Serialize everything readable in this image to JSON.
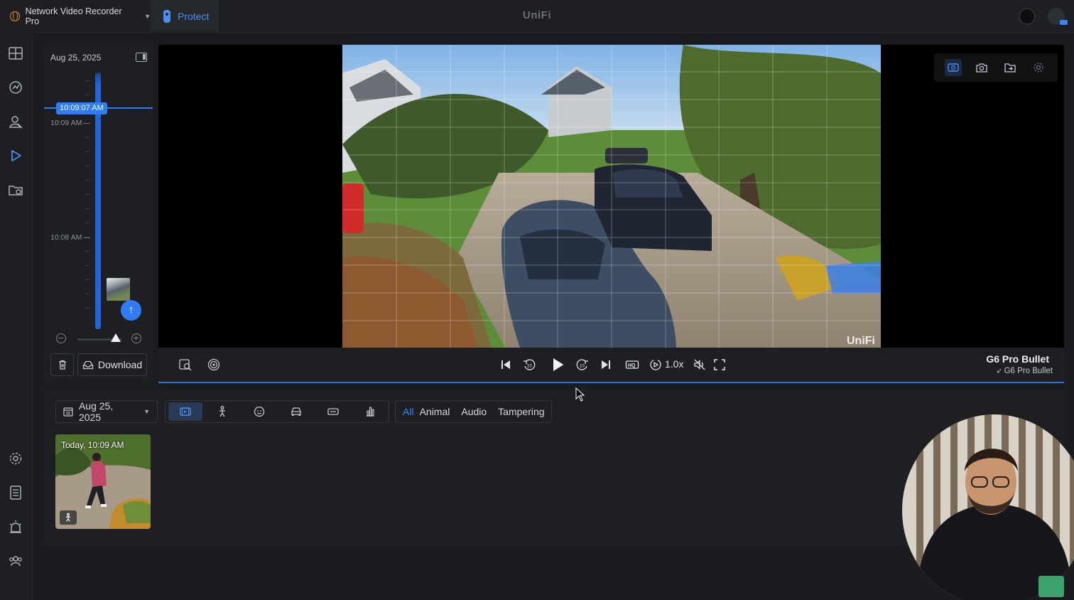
{
  "topbar": {
    "app_name": "Network Video Recorder Pro",
    "protect_label": "Protect",
    "brand": "UniFi"
  },
  "timeline": {
    "date": "Aug 25, 2025",
    "current_time": "10:09:07 AM",
    "labels": [
      "10:09 AM",
      "10:08 AM"
    ],
    "download_label": "Download"
  },
  "player": {
    "speed": "1.0x",
    "camera_name": "G6 Pro Bullet",
    "camera_sub": "G6 Pro Bullet",
    "watermark": "UniFi"
  },
  "events": {
    "date": "Aug 25, 2025",
    "filters": [
      "All",
      "Animal",
      "Audio",
      "Tampering"
    ],
    "active_filter": "All",
    "cards": [
      {
        "time": "Today, 10:09 AM",
        "type_icon": "person-icon"
      }
    ]
  },
  "colors": {
    "accent": "#2f7cf5",
    "protect_blue": "#4b8ff2",
    "panel": "#1d1f22",
    "background": "#1a1c1f"
  }
}
